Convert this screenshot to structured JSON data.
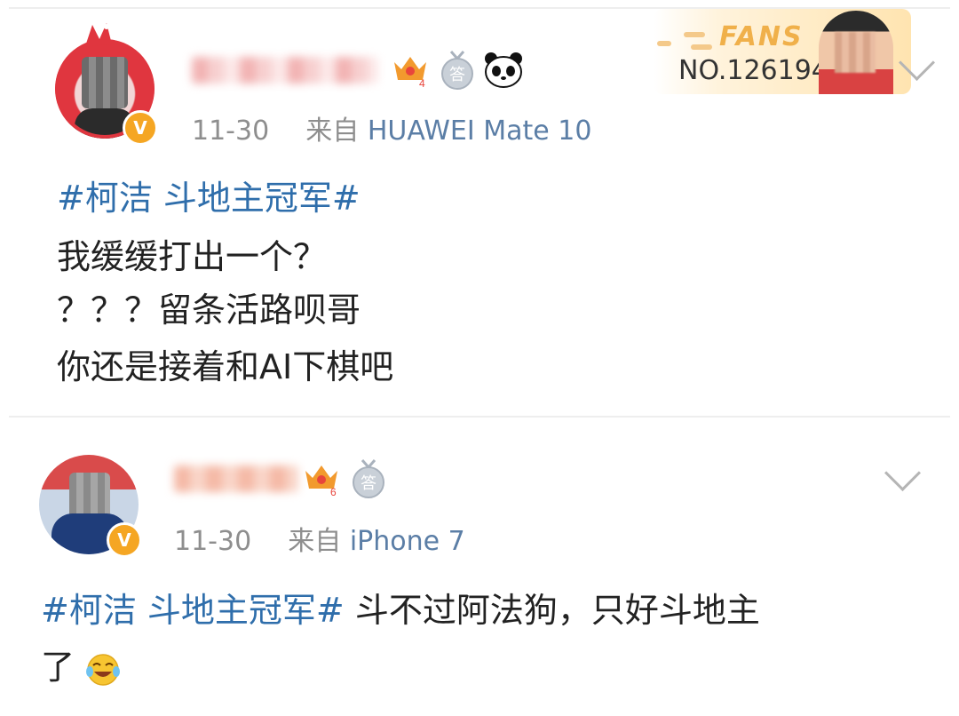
{
  "posts": [
    {
      "time": "11-30",
      "from_label": "来自",
      "source": "HUAWEI Mate 10",
      "badges": [
        "vip-crown-icon",
        "answer-medal-icon",
        "panda-icon"
      ],
      "vip_level": "4",
      "medal_text": "答",
      "fans_card": {
        "title": "FANS",
        "number": "NO.126194"
      },
      "lines": [
        {
          "tag": "#柯洁 斗地主冠军#",
          "text": ""
        },
        {
          "tag": "",
          "text": "我缓缓打出一个？"
        },
        {
          "tag": "",
          "text": "？？？留条活路呗哥"
        },
        {
          "tag": "",
          "text": "你还是接着和AI下棋吧"
        }
      ]
    },
    {
      "time": "11-30",
      "from_label": "来自",
      "source": "iPhone 7",
      "badges": [
        "vip-crown-icon",
        "answer-medal-icon"
      ],
      "vip_level": "6",
      "medal_text": "答",
      "lines": [
        {
          "tag": "#柯洁 斗地主冠军#",
          "text": " 斗不过阿法狗，只好斗地主"
        },
        {
          "tag": "",
          "text": "了",
          "emoji": "laughing-crying-emoji"
        }
      ]
    }
  ],
  "verified_mark": "V",
  "colors": {
    "topic_link": "#2f6eab",
    "source_link": "#5b7ea6",
    "meta_gray": "#8e8e8e",
    "verified": "#f5a623"
  }
}
